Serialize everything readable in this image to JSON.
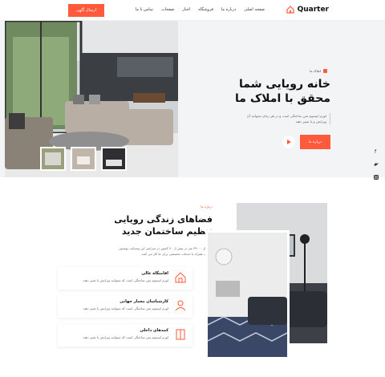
{
  "header": {
    "logo_text": "Quarter",
    "nav": [
      "صفحه اصلی",
      "درباره ما",
      "فروشگاه",
      "اخبار",
      "صفحات",
      "تماس با ما"
    ],
    "cta": "ارسال آگهی"
  },
  "hero": {
    "badge": "املاک ما",
    "title": "خانه رویایی شما محقق با املاک ما",
    "description": "لورم ایپسوم متن ساختگی است و در هر زمان میتوانید آن ویرایش و یا تغییر دهید",
    "button": "درباره ما"
  },
  "about": {
    "tag": "درباره ما",
    "title": "فضاهای زندگی رویایی تنظیم ساختمان جدید",
    "description": "بیش از ۳۹۰۰۰ نفر در بیش از ۷۰ کشور در سراسر این وبسایت پوشش جهانی، همراه با خدمات تخصصی برای ما کار می کنند.",
    "features": [
      {
        "title": "اقامتگاه عالی",
        "desc": "لورم ایپسوم متن ساختگی است که میتوانید ویرایش یا تغییر دهید",
        "icon": "house-icon"
      },
      {
        "title": "کارشناسان معمار جهانی",
        "desc": "لورم ایپسوم متن ساختگی است که میتوانید ویرایش یا تغییر دهید",
        "icon": "architect-icon"
      },
      {
        "title": "کمدهای داخلی",
        "desc": "لورم ایپسوم متن ساختگی است که میتوانید ویرایش یا تغییر دهید",
        "icon": "closet-icon"
      }
    ]
  },
  "colors": {
    "accent": "#ff5a3c"
  }
}
